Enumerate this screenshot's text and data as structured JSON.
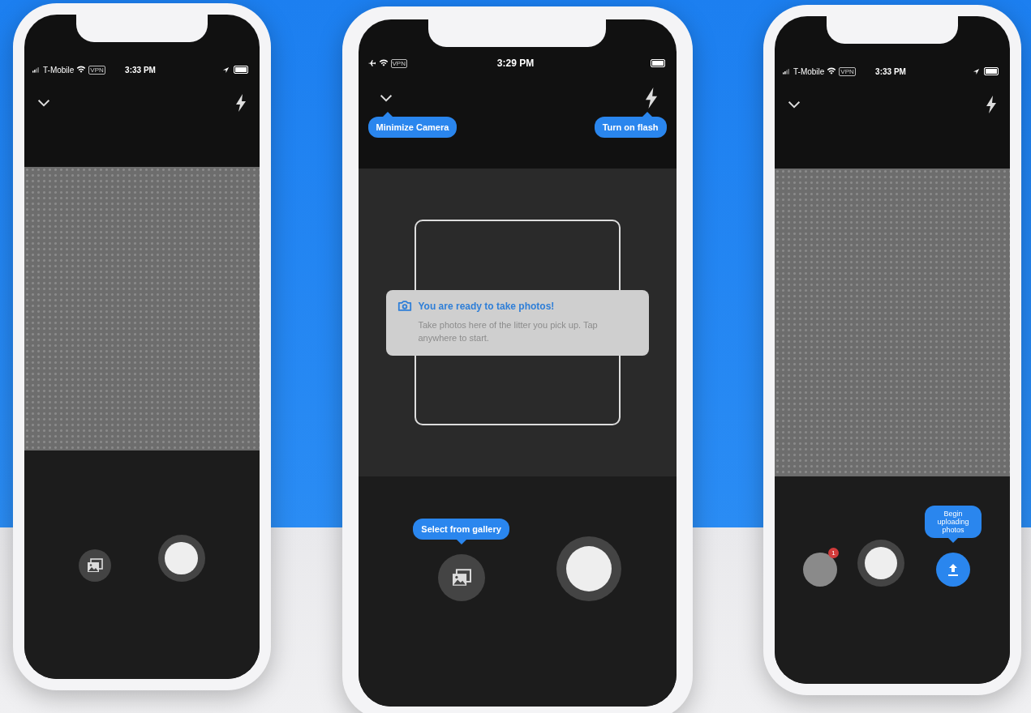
{
  "phones": [
    {
      "status_bar": {
        "kind": "carrier",
        "carrier": "T-Mobile",
        "vpn": "VPN",
        "time": "3:33 PM"
      },
      "preview": {
        "kind": "photo"
      },
      "left_button": {
        "kind": "gallery"
      }
    },
    {
      "status_bar": {
        "kind": "airplane",
        "vpn": "VPN",
        "time": "3:29 PM"
      },
      "tips": {
        "minimize": "Minimize Camera",
        "flash": "Turn on flash",
        "gallery": "Select from gallery"
      },
      "preview": {
        "kind": "empty",
        "notice": {
          "title": "You are ready to take photos!",
          "body": "Take photos here of the litter you pick up. Tap anywhere to start."
        }
      },
      "left_button": {
        "kind": "gallery"
      }
    },
    {
      "status_bar": {
        "kind": "carrier",
        "carrier": "T-Mobile",
        "vpn": "VPN",
        "time": "3:33 PM"
      },
      "tips": {
        "upload": "Begin uploading photos"
      },
      "preview": {
        "kind": "photo"
      },
      "left_button": {
        "kind": "thumbnail",
        "badge": "1"
      }
    }
  ]
}
